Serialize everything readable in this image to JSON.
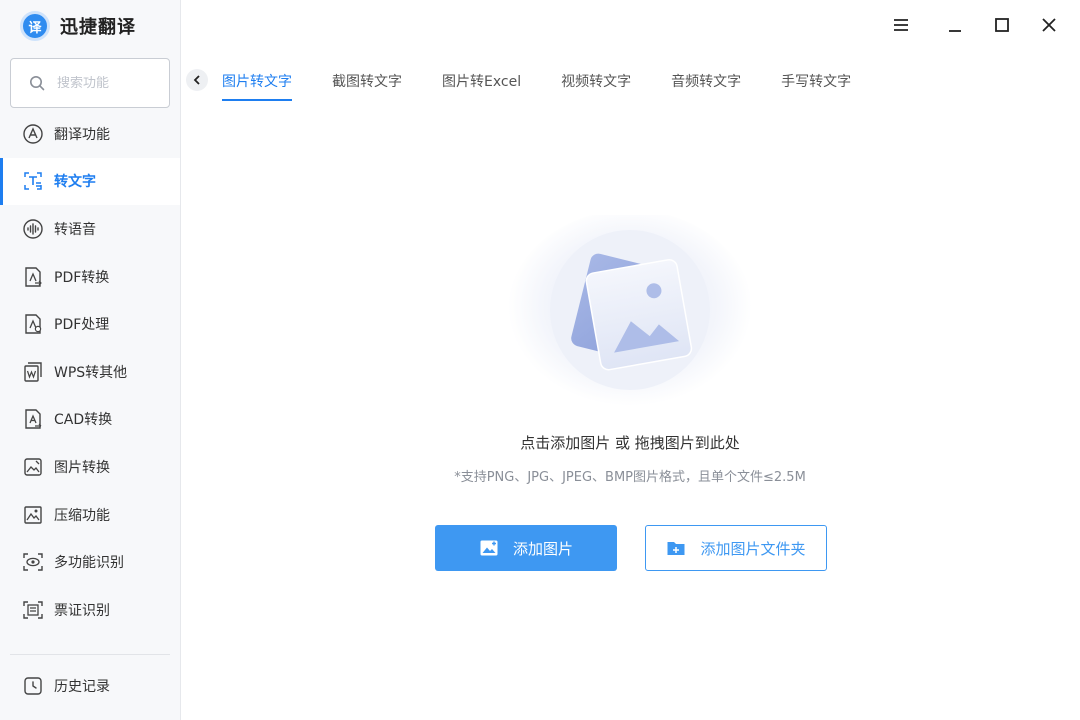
{
  "app": {
    "name": "迅捷翻译",
    "logo_glyph": "译"
  },
  "search": {
    "placeholder": "搜索功能"
  },
  "sidebar": {
    "items": [
      {
        "label": "翻译功能",
        "icon": "translate-icon",
        "active": false
      },
      {
        "label": "转文字",
        "icon": "text-convert-icon",
        "active": true
      },
      {
        "label": "转语音",
        "icon": "voice-icon",
        "active": false
      },
      {
        "label": "PDF转换",
        "icon": "pdf-convert-icon",
        "active": false
      },
      {
        "label": "PDF处理",
        "icon": "pdf-process-icon",
        "active": false
      },
      {
        "label": "WPS转其他",
        "icon": "wps-convert-icon",
        "active": false
      },
      {
        "label": "CAD转换",
        "icon": "cad-convert-icon",
        "active": false
      },
      {
        "label": "图片转换",
        "icon": "image-convert-icon",
        "active": false
      },
      {
        "label": "压缩功能",
        "icon": "compress-icon",
        "active": false
      },
      {
        "label": "多功能识别",
        "icon": "eye-recognize-icon",
        "active": false
      },
      {
        "label": "票证识别",
        "icon": "ticket-recognize-icon",
        "active": false
      }
    ],
    "history_label": "历史记录"
  },
  "tabs": [
    {
      "label": "图片转文字",
      "active": true
    },
    {
      "label": "截图转文字",
      "active": false
    },
    {
      "label": "图片转Excel",
      "active": false
    },
    {
      "label": "视频转文字",
      "active": false
    },
    {
      "label": "音频转文字",
      "active": false
    },
    {
      "label": "手写转文字",
      "active": false
    }
  ],
  "upload": {
    "title": "点击添加图片 或 拖拽图片到此处",
    "hint": "*支持PNG、JPG、JPEG、BMP图片格式，且单个文件≤2.5M",
    "add_image_label": "添加图片",
    "add_folder_label": "添加图片文件夹"
  },
  "colors": {
    "accent": "#1e7ef0",
    "button": "#3e98f2",
    "sidebar_bg": "#f7f8fa"
  }
}
